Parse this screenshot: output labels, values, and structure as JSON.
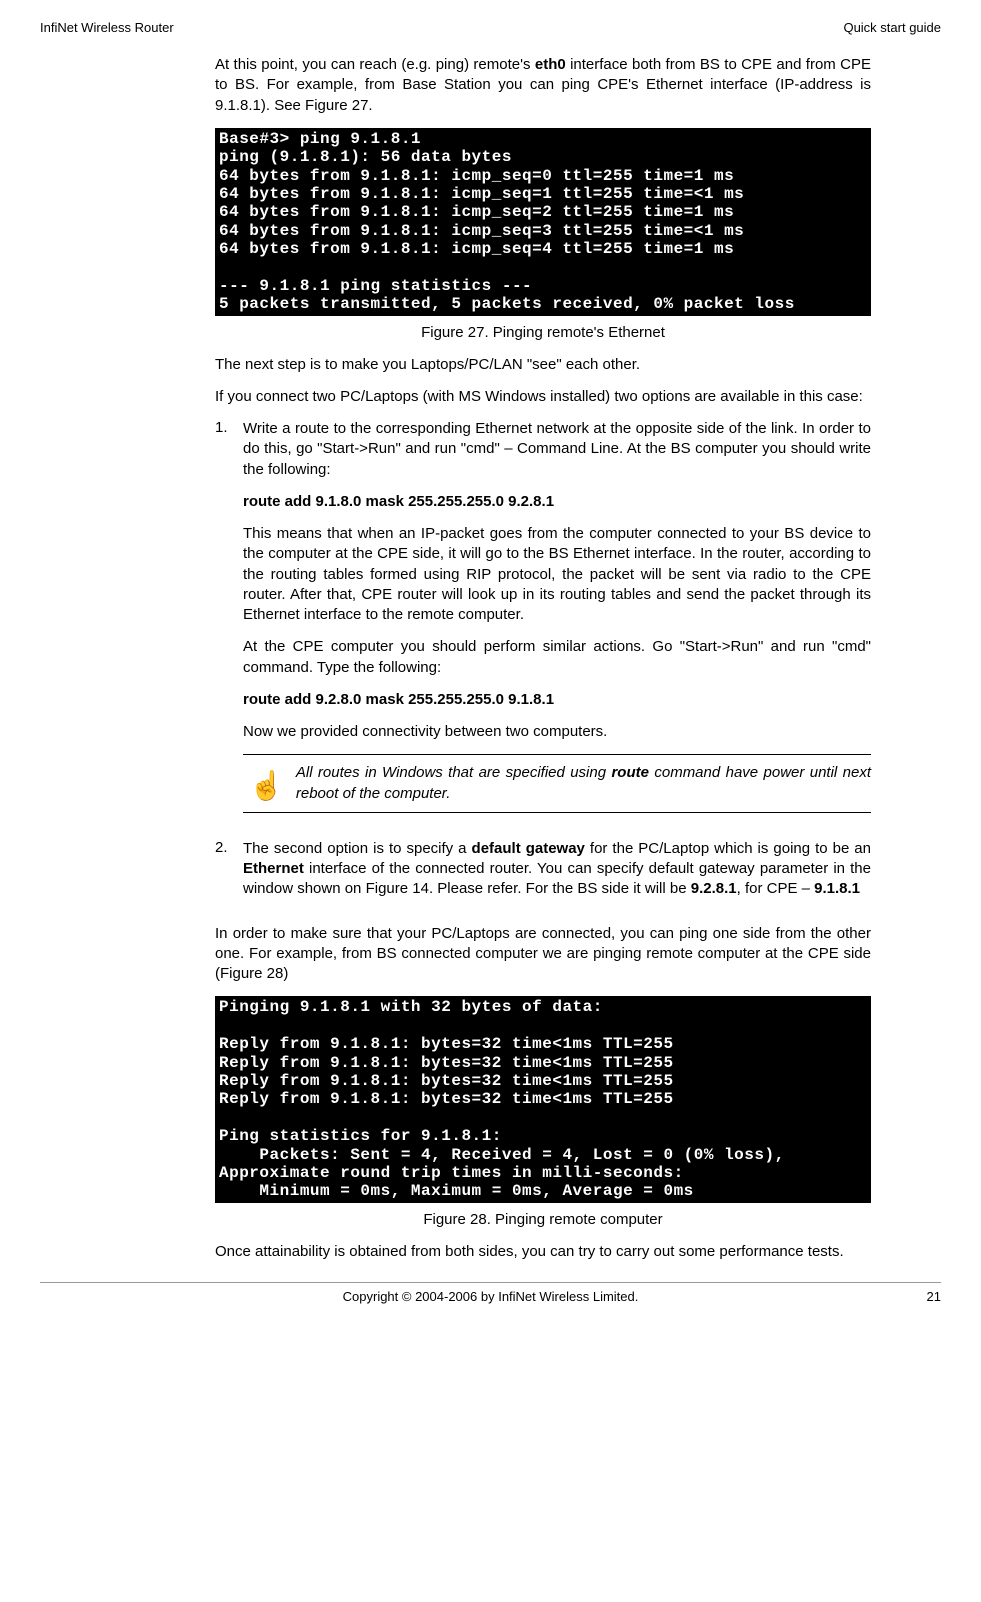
{
  "header": {
    "left": "InfiNet Wireless Router",
    "right": "Quick start guide"
  },
  "p1_pre": "At this point, you can reach (e.g. ping) remote's ",
  "p1_bold": "eth0",
  "p1_post": " interface both from BS to CPE and from CPE to BS. For example, from Base Station you can ping CPE's Ethernet interface (IP-address is 9.1.8.1). See Figure 27.",
  "terminal1": "Base#3> ping 9.1.8.1\nping (9.1.8.1): 56 data bytes\n64 bytes from 9.1.8.1: icmp_seq=0 ttl=255 time=1 ms\n64 bytes from 9.1.8.1: icmp_seq=1 ttl=255 time=<1 ms\n64 bytes from 9.1.8.1: icmp_seq=2 ttl=255 time=1 ms\n64 bytes from 9.1.8.1: icmp_seq=3 ttl=255 time=<1 ms\n64 bytes from 9.1.8.1: icmp_seq=4 ttl=255 time=1 ms\n\n--- 9.1.8.1 ping statistics ---\n5 packets transmitted, 5 packets received, 0% packet loss",
  "caption1": "Figure 27. Pinging remote's Ethernet",
  "p2": "The next step is to make you Laptops/PC/LAN \"see\" each other.",
  "p3": "If you connect two PC/Laptops (with MS Windows installed) two options are available in this case:",
  "li1_num": "1.",
  "li1_p1": "Write a route to the corresponding Ethernet network at the opposite side of the link. In order to do this, go \"Start->Run\" and run \"cmd\" – Command Line. At the BS computer you should write the following:",
  "route1": "route add 9.1.8.0 mask 255.255.255.0 9.2.8.1",
  "li1_p2": "This means that when an IP-packet goes from the computer connected to your BS device to the computer at the CPE side, it will go to the BS Ethernet interface. In the router, according to the routing tables formed using RIP protocol, the packet will be sent via radio to the CPE router. After that, CPE router will look up in its routing tables and send the packet through its Ethernet interface to the remote computer.",
  "li1_p3": "At the CPE computer you should perform similar actions. Go \"Start->Run\" and run \"cmd\" command. Type the following:",
  "route2": "route add 9.2.8.0 mask 255.255.255.0 9.1.8.1",
  "li1_p4": "Now we provided connectivity between two computers.",
  "note_pre": "All routes in Windows that are specified using ",
  "note_bold": "route",
  "note_post": " command have power until next reboot of the computer.",
  "li2_num": "2.",
  "li2_pre": "The second option is to specify a ",
  "li2_b1": "default gateway",
  "li2_mid1": " for the PC/Laptop which is going to be an ",
  "li2_b2": "Ethernet",
  "li2_mid2": " interface of the connected router. You can specify default gateway parameter in the window shown on Figure 14. Please refer. For the BS side it will be ",
  "li2_b3": "9.2.8.1",
  "li2_mid3": ", for CPE – ",
  "li2_b4": "9.1.8.1",
  "p4": "In order to make sure that your PC/Laptops are connected, you can ping one side from the other one. For example, from BS connected computer we are pinging remote computer at the CPE side (Figure 28)",
  "terminal2": "Pinging 9.1.8.1 with 32 bytes of data:\n\nReply from 9.1.8.1: bytes=32 time<1ms TTL=255\nReply from 9.1.8.1: bytes=32 time<1ms TTL=255\nReply from 9.1.8.1: bytes=32 time<1ms TTL=255\nReply from 9.1.8.1: bytes=32 time<1ms TTL=255\n\nPing statistics for 9.1.8.1:\n    Packets: Sent = 4, Received = 4, Lost = 0 (0% loss),\nApproximate round trip times in milli-seconds:\n    Minimum = 0ms, Maximum = 0ms, Average = 0ms",
  "caption2": "Figure 28. Pinging remote computer",
  "p5": "Once attainability is obtained from both sides, you can try to carry out some performance tests.",
  "footer": {
    "copyright": "Copyright © 2004-2006 by InfiNet Wireless Limited.",
    "page": "21"
  }
}
